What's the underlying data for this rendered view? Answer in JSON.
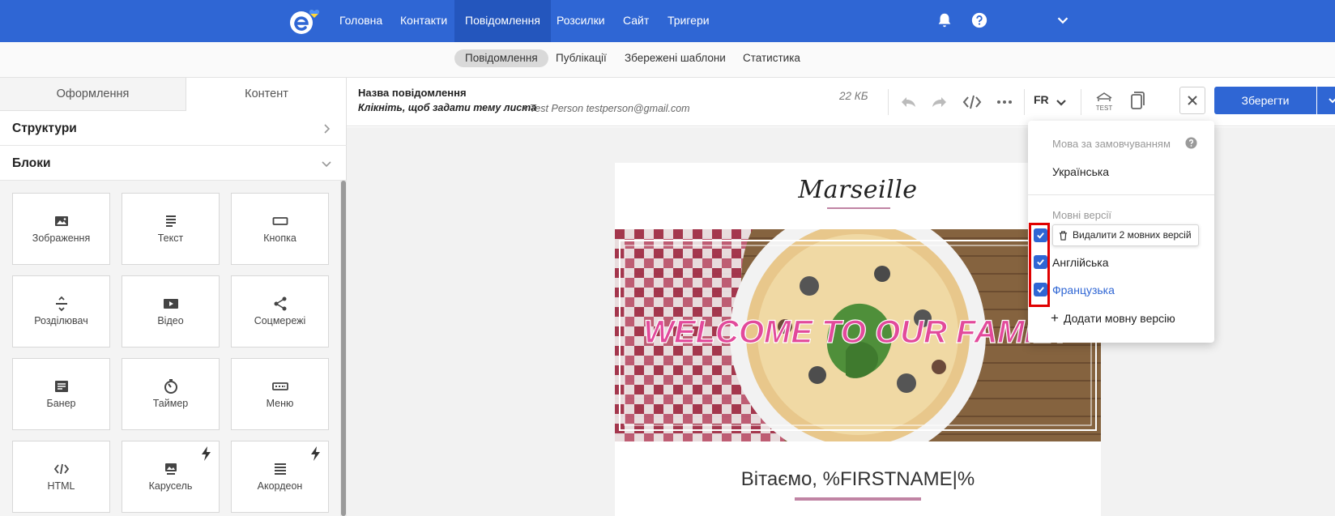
{
  "topnav": {
    "items": [
      "Головна",
      "Контакти",
      "Повідомлення",
      "Розсилки",
      "Сайт",
      "Тригери"
    ],
    "active": "Повідомлення"
  },
  "subnav": {
    "items": [
      "Повідомлення",
      "Публікації",
      "Збережені шаблони",
      "Статистика"
    ],
    "active": "Повідомлення"
  },
  "sidebar": {
    "tabs": [
      "Оформлення",
      "Контент"
    ],
    "active_tab": "Контент",
    "sections": [
      "Структури",
      "Блоки"
    ],
    "blocks": [
      {
        "label": "Зображення",
        "icon": "image-icon"
      },
      {
        "label": "Текст",
        "icon": "text-icon"
      },
      {
        "label": "Кнопка",
        "icon": "button-icon"
      },
      {
        "label": "Розділювач",
        "icon": "divider-icon"
      },
      {
        "label": "Відео",
        "icon": "video-icon"
      },
      {
        "label": "Соцмережі",
        "icon": "share-icon"
      },
      {
        "label": "Банер",
        "icon": "banner-icon"
      },
      {
        "label": "Таймер",
        "icon": "timer-icon"
      },
      {
        "label": "Меню",
        "icon": "menu-icon"
      },
      {
        "label": "HTML",
        "icon": "code-icon"
      },
      {
        "label": "Карусель",
        "icon": "carousel-icon",
        "amp": true
      },
      {
        "label": "Акордеон",
        "icon": "accordion-icon",
        "amp": true
      }
    ]
  },
  "editor": {
    "message_name": "Назва повідомлення",
    "subject": "Клікніть, щоб задати тему листа",
    "sender": "• Test Person testperson@gmail.com",
    "size": "22 КБ",
    "lang_code": "FR",
    "test_label": "TEST",
    "save_label": "Зберегти"
  },
  "email": {
    "brand": "Marseille",
    "hero_text": "WELCOME TO OUR FAMILY",
    "greeting": "Вітаємо, %FIRSTNAME|%"
  },
  "lang_dropdown": {
    "default_label": "Мова за замовчуванням",
    "default_lang": "Українська",
    "versions_label": "Мовні версії",
    "delete_tooltip": "Видалити 2 мовних версій",
    "versions": [
      {
        "name": "Англійська",
        "checked": true,
        "active": false
      },
      {
        "name": "Французька",
        "checked": true,
        "active": true
      }
    ],
    "add_label": "Додати мовну версію"
  },
  "colors": {
    "brand_blue": "#2f66d4",
    "highlight_red": "#e00000",
    "accent_pink": "#c084a4",
    "hero_text": "#e24a9b"
  }
}
